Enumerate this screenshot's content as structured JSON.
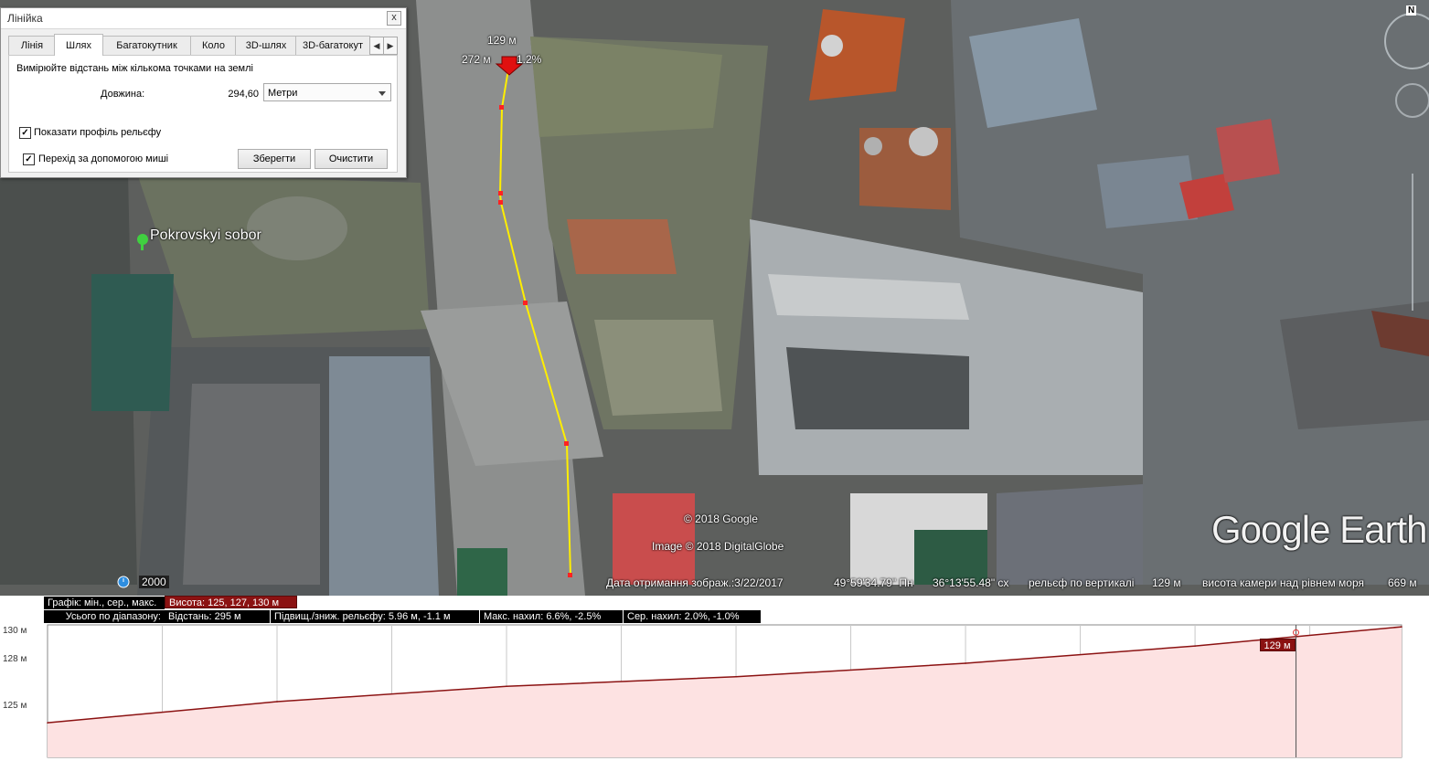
{
  "ruler": {
    "title": "Лінійка",
    "close_label": "x",
    "tabs": [
      {
        "label": "Лінія",
        "active": false
      },
      {
        "label": "Шлях",
        "active": true
      },
      {
        "label": "Багатокутник",
        "active": false
      },
      {
        "label": "Коло",
        "active": false
      },
      {
        "label": "3D-шлях",
        "active": false
      },
      {
        "label": "3D-багатокут",
        "active": false
      }
    ],
    "tab_prev": "◀",
    "tab_next": "▶",
    "description": "Вимірюйте відстань між кількома точками на землі",
    "length_label": "Довжина:",
    "length_value": "294,60",
    "unit_selected": "Метри",
    "show_profile_label": "Показати профіль рельєфу",
    "show_profile_checked": true,
    "mouse_nav_label": "Перехід за допомогою миші",
    "mouse_nav_checked": true,
    "check_mark": "✓",
    "save_label": "Зберегти",
    "clear_label": "Очистити"
  },
  "map": {
    "placemark_label": "Pokrovskyi sobor",
    "path_tooltip": {
      "elevation": "129 м",
      "distance": "272 м",
      "slope": "1.2%"
    },
    "copyright_google": "© 2018 Google",
    "copyright_image": "Image © 2018 DigitalGlobe",
    "brand": "Google Earth",
    "historical_year": "2000",
    "compass_north": "N",
    "path_color": "#ffee00",
    "status": {
      "imagery_date": "Дата отримання зображ.:3/22/2017",
      "lat": "49°59'34.79\" Пн",
      "lon": "36°13'55.48\" сх",
      "elevation_label": "рельєф по вертикалі",
      "elevation_value": "129 м",
      "eye_alt_label": "висота камери над рівнем моря",
      "eye_alt_value": "669 м"
    }
  },
  "profile": {
    "graph_label": "Графік: мін., сер., макс.",
    "elevation_stats": "Висота: 125, 127, 130 м",
    "range_label": "Усього по діапазону:",
    "distance": "Відстань: 295 м",
    "gain_loss": "Підвищ./зниж. рельєфу: 5.96 м, -1.1 м",
    "max_slope": "Макс. нахил: 6.6%, -2.5%",
    "avg_slope": "Сер. нахил: 2.0%, -1.0%",
    "y_ticks": [
      "130 м",
      "128 м",
      "125 м"
    ],
    "cursor_label": "129 м",
    "fill_color": "#fde2e2",
    "line_color": "#8b1212"
  },
  "chart_data": {
    "type": "area",
    "x": [
      0,
      50,
      100,
      150,
      200,
      250,
      295
    ],
    "values": [
      125.0,
      126.1,
      126.9,
      127.4,
      128.1,
      129.0,
      130.0
    ],
    "xlabel": "",
    "ylabel": "",
    "ylim": [
      123.2,
      130.1
    ],
    "cursor_x": 272,
    "cursor_value": 129
  }
}
